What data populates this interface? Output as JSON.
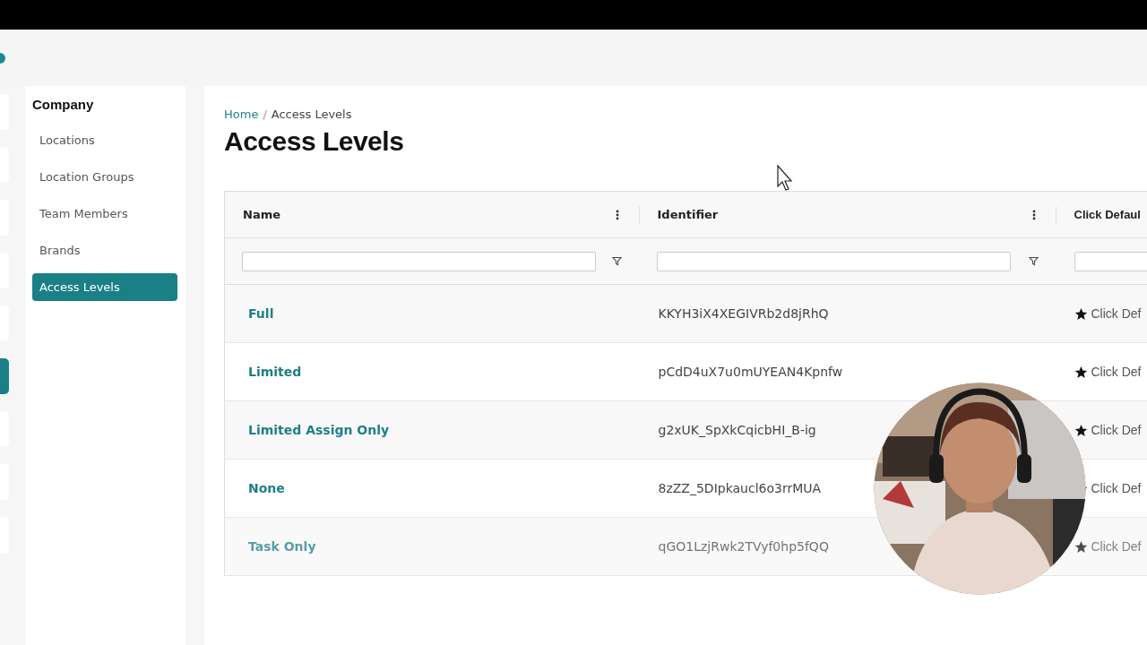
{
  "rail": [
    {
      "selected": false
    },
    {
      "selected": false
    },
    {
      "selected": false
    },
    {
      "selected": false
    },
    {
      "selected": false
    },
    {
      "selected": true
    },
    {
      "selected": false
    },
    {
      "selected": false
    },
    {
      "selected": false
    }
  ],
  "sidebar": {
    "title": "Company",
    "items": [
      {
        "label": "Locations",
        "selected": false
      },
      {
        "label": "Location Groups",
        "selected": false
      },
      {
        "label": "Team Members",
        "selected": false
      },
      {
        "label": "Brands",
        "selected": false
      },
      {
        "label": "Access Levels",
        "selected": true
      }
    ]
  },
  "breadcrumb": [
    {
      "label": "Home",
      "kind": "link"
    },
    {
      "label": "/",
      "kind": "separator"
    },
    {
      "label": "Access Levels",
      "kind": "current"
    }
  ],
  "page_title": "Access Levels",
  "table": {
    "columns": [
      {
        "label": "Name"
      },
      {
        "label": "Identifier"
      },
      {
        "label": "Click Defaul"
      }
    ],
    "rows": [
      {
        "name": "Full",
        "identifier": "KKYH3iX4XEGIVRb2d8jRhQ",
        "action": "Click Def"
      },
      {
        "name": "Limited",
        "identifier": "pCdD4uX7u0mUYEAN4Kpnfw",
        "action": "Click Def"
      },
      {
        "name": "Limited Assign Only",
        "identifier": "g2xUK_SpXkCqicbHI_B-ig",
        "action": "Click Def"
      },
      {
        "name": "None",
        "identifier": "8zZZ_5DIpkaucl6o3rrMUA",
        "action": "Click Def"
      },
      {
        "name": "Task Only",
        "identifier": "qGO1LzjRwk2TVyf0hp5fQQ",
        "action": "Click Def"
      }
    ]
  }
}
